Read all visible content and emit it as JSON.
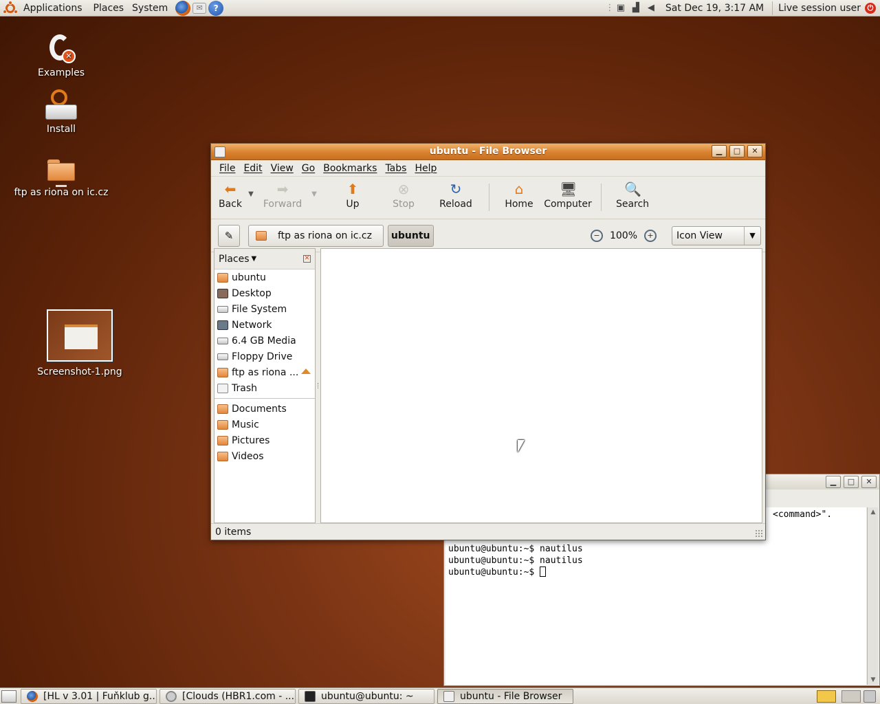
{
  "top_panel": {
    "menus": [
      "Applications",
      "Places",
      "System"
    ],
    "launchers": [
      {
        "icon": "firefox-icon"
      },
      {
        "icon": "mail-icon"
      },
      {
        "icon": "help-icon"
      }
    ],
    "clock": "Sat Dec 19,  3:17 AM",
    "session": "Live session user"
  },
  "desktop_icons": [
    {
      "label": "Examples",
      "icon": "examples-icon"
    },
    {
      "label": "Install",
      "icon": "install-icon"
    },
    {
      "label": "ftp as riona on ic.cz",
      "icon": "network-folder-icon"
    },
    {
      "label": "Screenshot-1.png",
      "icon": "image-thumbnail-icon"
    }
  ],
  "file_browser": {
    "title": "ubuntu - File Browser",
    "menu": [
      "File",
      "Edit",
      "View",
      "Go",
      "Bookmarks",
      "Tabs",
      "Help"
    ],
    "toolbar": {
      "back": "Back",
      "forward": "Forward",
      "up": "Up",
      "stop": "Stop",
      "reload": "Reload",
      "home": "Home",
      "computer": "Computer",
      "search": "Search"
    },
    "location": {
      "crumbs": [
        "ftp as riona on ic.cz",
        "ubuntu"
      ],
      "zoom": "100%",
      "view_mode": "Icon View"
    },
    "sidebar": {
      "header": "Places",
      "places": [
        {
          "label": "ubuntu",
          "icon": "home-icon"
        },
        {
          "label": "Desktop",
          "icon": "desktop-icon"
        },
        {
          "label": "File System",
          "icon": "drive-icon"
        },
        {
          "label": "Network",
          "icon": "network-icon"
        },
        {
          "label": "6.4 GB Media",
          "icon": "drive-icon"
        },
        {
          "label": "Floppy Drive",
          "icon": "drive-icon"
        },
        {
          "label": "ftp as riona ...",
          "icon": "network-folder-icon"
        },
        {
          "label": "Trash",
          "icon": "trash-icon"
        }
      ],
      "bookmarks": [
        {
          "label": "Documents",
          "icon": "folder-icon"
        },
        {
          "label": "Music",
          "icon": "folder-icon"
        },
        {
          "label": "Pictures",
          "icon": "folder-icon"
        },
        {
          "label": "Videos",
          "icon": "folder-icon"
        }
      ]
    },
    "status": "0 items"
  },
  "terminal": {
    "top_text": "<command>\".",
    "lines": [
      "ubuntu@ubuntu:~$ nautilus",
      "ubuntu@ubuntu:~$ nautilus",
      "ubuntu@ubuntu:~$ "
    ]
  },
  "taskbar": [
    {
      "label": "[HL v 3.01 | Fuňklub g...",
      "icon": "firefox-icon"
    },
    {
      "label": "[Clouds (HBR1.com - ...",
      "icon": "gear-icon"
    },
    {
      "label": "ubuntu@ubuntu: ~",
      "icon": "terminal-icon"
    },
    {
      "label": "ubuntu - File Browser",
      "icon": "file-browser-icon"
    }
  ],
  "colors": {
    "titlebar_accent": "#d8822f",
    "desktop_bg": "#7a3414"
  }
}
